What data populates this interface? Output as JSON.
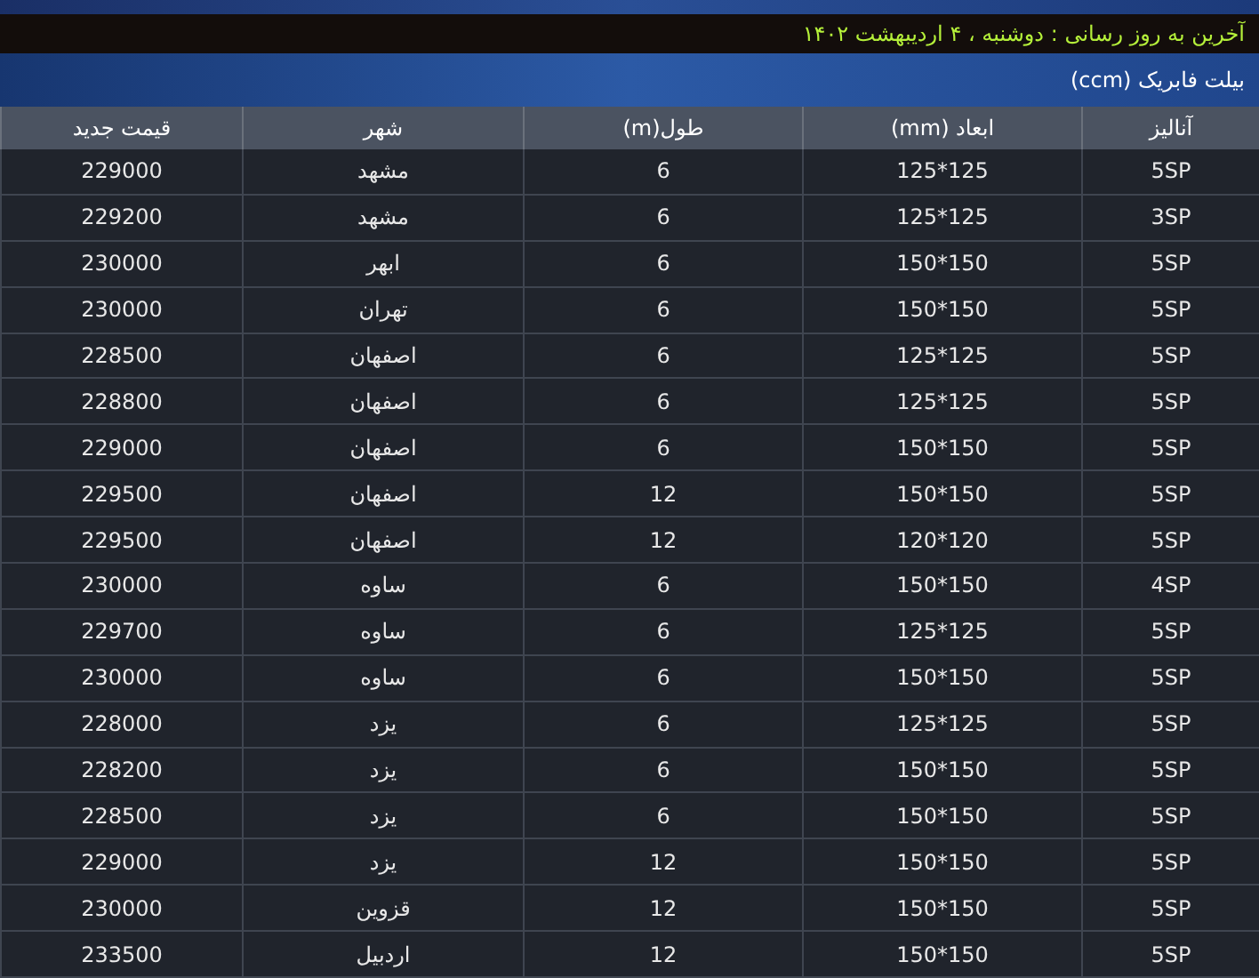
{
  "update_notice": "آخرین به روز رسانی : دوشنبه ، ۴ اردیبهشت ۱۴۰۲",
  "section_title": "بیلت فابریک (ccm)",
  "table": {
    "columns": [
      "آنالیز",
      "ابعاد (mm)",
      "طول(m)",
      "شهر",
      "قیمت جدید"
    ],
    "rows": [
      [
        "5SP",
        "125*125",
        "6",
        "مشهد",
        "229000"
      ],
      [
        "3SP",
        "125*125",
        "6",
        "مشهد",
        "229200"
      ],
      [
        "5SP",
        "150*150",
        "6",
        "ابهر",
        "230000"
      ],
      [
        "5SP",
        "150*150",
        "6",
        "تهران",
        "230000"
      ],
      [
        "5SP",
        "125*125",
        "6",
        "اصفهان",
        "228500"
      ],
      [
        "5SP",
        "125*125",
        "6",
        "اصفهان",
        "228800"
      ],
      [
        "5SP",
        "150*150",
        "6",
        "اصفهان",
        "229000"
      ],
      [
        "5SP",
        "150*150",
        "12",
        "اصفهان",
        "229500"
      ],
      [
        "5SP",
        "120*120",
        "12",
        "اصفهان",
        "229500"
      ],
      [
        "4SP",
        "150*150",
        "6",
        "ساوه",
        "230000"
      ],
      [
        "5SP",
        "125*125",
        "6",
        "ساوه",
        "229700"
      ],
      [
        "5SP",
        "150*150",
        "6",
        "ساوه",
        "230000"
      ],
      [
        "5SP",
        "125*125",
        "6",
        "یزد",
        "228000"
      ],
      [
        "5SP",
        "150*150",
        "6",
        "یزد",
        "228200"
      ],
      [
        "5SP",
        "150*150",
        "6",
        "یزد",
        "228500"
      ],
      [
        "5SP",
        "150*150",
        "12",
        "یزد",
        "229000"
      ],
      [
        "5SP",
        "150*150",
        "12",
        "قزوین",
        "230000"
      ],
      [
        "5SP",
        "150*150",
        "12",
        "اردبیل",
        "233500"
      ]
    ]
  }
}
